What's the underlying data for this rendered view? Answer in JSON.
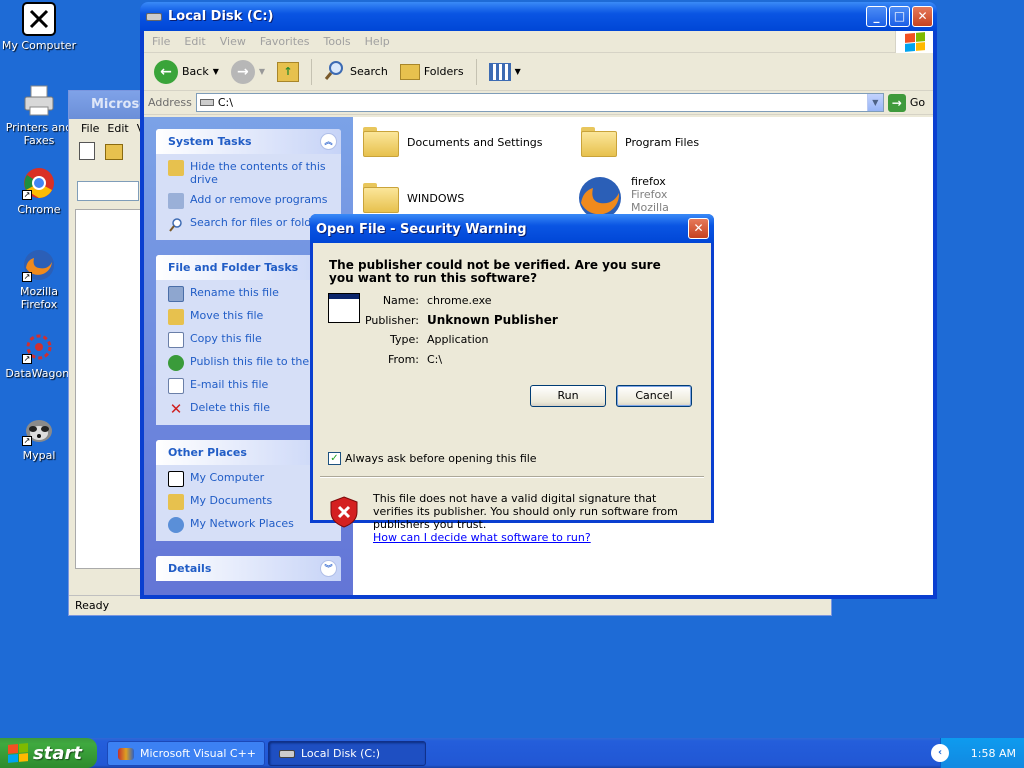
{
  "desktop": {
    "icons": [
      {
        "label": "My Computer"
      },
      {
        "label": "Printers and Faxes"
      },
      {
        "label": "Chrome"
      },
      {
        "label": "Mozilla Firefox"
      },
      {
        "label": "DataWagon."
      },
      {
        "label": "Mypal"
      }
    ]
  },
  "bg_window": {
    "title": "Microso",
    "menu": [
      "File",
      "Edit",
      "V"
    ],
    "status": "Ready"
  },
  "explorer": {
    "title": "Local Disk (C:)",
    "menu": [
      "File",
      "Edit",
      "View",
      "Favorites",
      "Tools",
      "Help"
    ],
    "toolbar": {
      "back": "Back",
      "search": "Search",
      "folders": "Folders"
    },
    "address_label": "Address",
    "address_value": "C:\\",
    "go_label": "Go",
    "system_tasks": {
      "title": "System Tasks",
      "items": [
        "Hide the contents of this drive",
        "Add or remove programs",
        "Search for files or folders"
      ]
    },
    "file_tasks": {
      "title": "File and Folder Tasks",
      "items": [
        "Rename this file",
        "Move this file",
        "Copy this file",
        "Publish this file to the Web",
        "E-mail this file",
        "Delete this file"
      ]
    },
    "other_places": {
      "title": "Other Places",
      "items": [
        "My Computer",
        "My Documents",
        "My Network Places"
      ]
    },
    "details_title": "Details",
    "files": [
      {
        "name": "Documents and Settings"
      },
      {
        "name": "Program Files"
      },
      {
        "name": "WINDOWS"
      },
      {
        "name": "firefox",
        "line2": "Firefox",
        "line3": "Mozilla"
      }
    ]
  },
  "dialog": {
    "title": "Open File - Security Warning",
    "question": "The publisher could not be verified.  Are you sure you want to run this software?",
    "props": [
      {
        "label": "Name:",
        "value": "chrome.exe"
      },
      {
        "label": "Publisher:",
        "value": "Unknown Publisher"
      },
      {
        "label": "Type:",
        "value": "Application"
      },
      {
        "label": "From:",
        "value": "C:\\"
      }
    ],
    "run_label": "Run",
    "cancel_label": "Cancel",
    "checkbox_label": "Always ask before opening this file",
    "checkbox_checked": true,
    "warning": "This file does not have a valid digital signature that verifies its publisher.  You should only run software from publishers you trust.",
    "link": "How can I decide what software to run?"
  },
  "taskbar": {
    "start": "start",
    "tasks": [
      "Microsoft Visual C++",
      "Local Disk (C:)"
    ],
    "clock": "1:58 AM"
  },
  "colors": {
    "desktop": "#1e6bd6",
    "title_blue": "#0a55e3",
    "link": "#215dc6"
  }
}
